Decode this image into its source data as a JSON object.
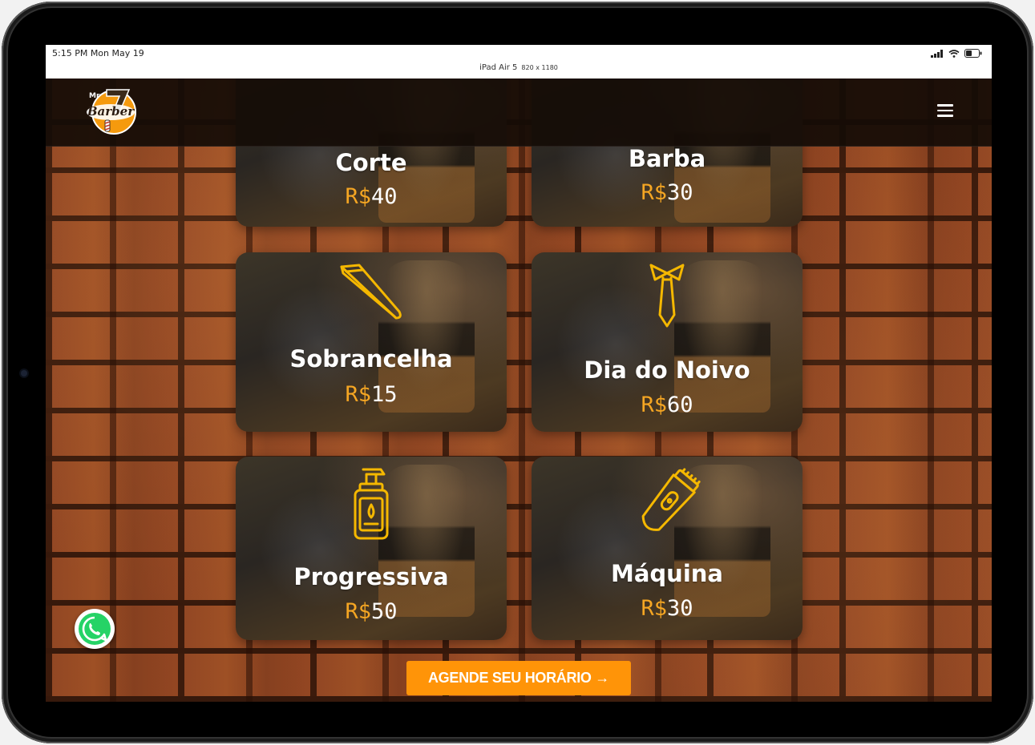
{
  "status_bar": {
    "time": "5:15 PM  Mon May 19",
    "device_name": "iPad Air 5",
    "device_resolution": "820 x 1180"
  },
  "header": {
    "logo_text_top": "Mr",
    "logo_text_main": "Barber",
    "logo_number": "7",
    "menu_icon": "hamburger-menu-icon"
  },
  "services": [
    {
      "name": "Corte",
      "currency": "R$",
      "price": "40",
      "icon": "scissors-icon"
    },
    {
      "name": "Barba",
      "currency": "R$",
      "price": "30",
      "icon": "beard-icon"
    },
    {
      "name": "Sobrancelha",
      "currency": "R$",
      "price": "15",
      "icon": "tweezers-icon"
    },
    {
      "name": "Dia do Noivo",
      "currency": "R$",
      "price": "60",
      "icon": "tie-icon"
    },
    {
      "name": "Progressiva",
      "currency": "R$",
      "price": "50",
      "icon": "pump-bottle-icon"
    },
    {
      "name": "Máquina",
      "currency": "R$",
      "price": "30",
      "icon": "hair-clipper-icon"
    }
  ],
  "cta": {
    "label": "AGENDE SEU HORÁRIO →"
  },
  "floating": {
    "icon": "whatsapp-icon"
  },
  "colors": {
    "accent": "#f5a623",
    "button": "#ff9408",
    "icon_stroke": "#f5b800"
  }
}
